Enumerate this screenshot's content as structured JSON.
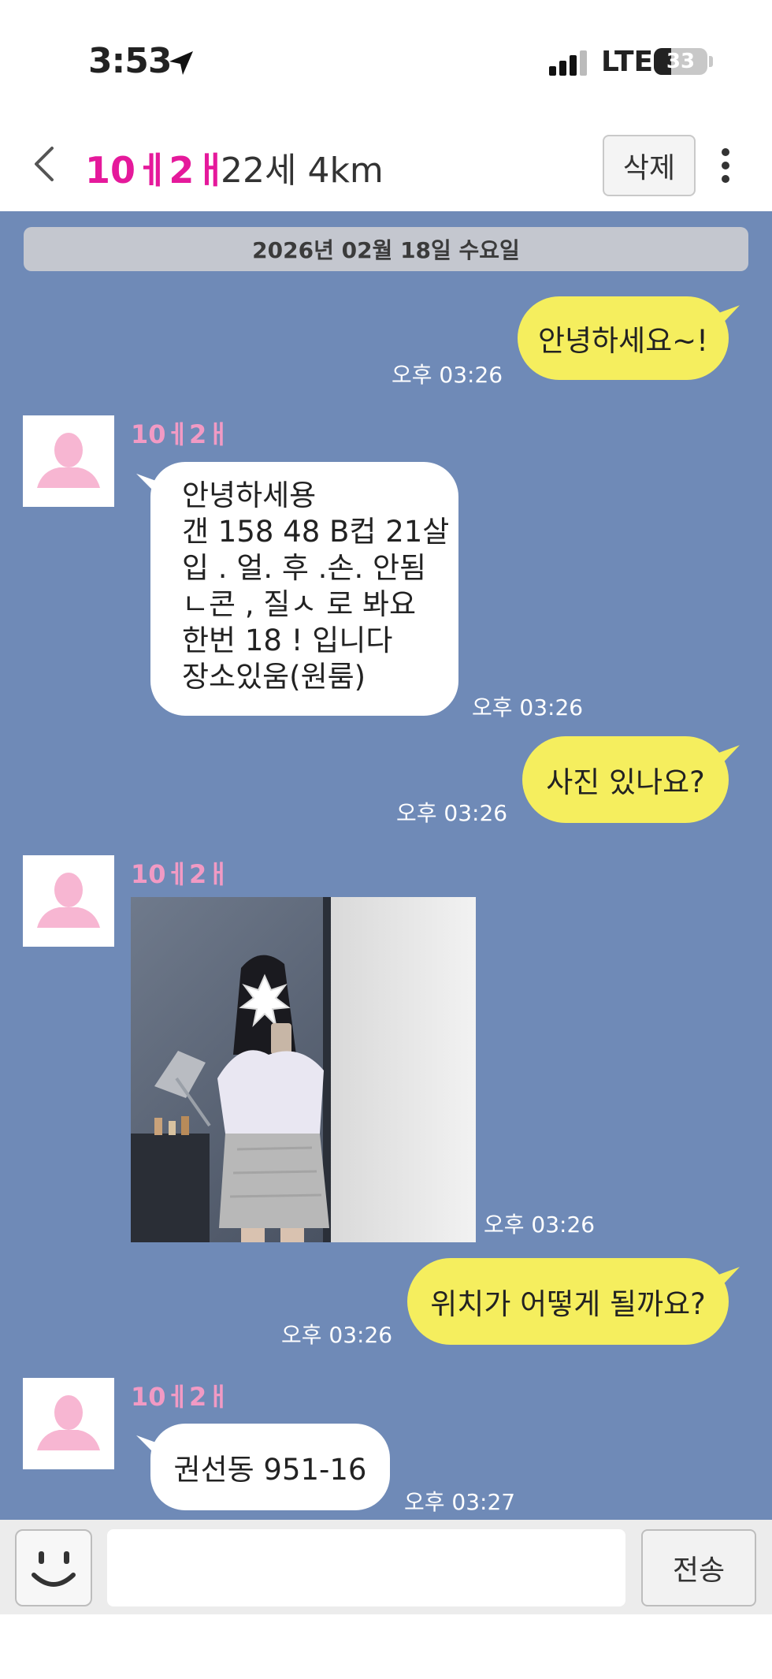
{
  "status_bar": {
    "time": "3:53",
    "network": "LTE",
    "battery": "33",
    "battery_level_percent": 33,
    "signal_bars": 3,
    "icons": [
      "location-arrow-icon",
      "signal-icon",
      "battery-icon"
    ]
  },
  "header": {
    "name": "10ㅔ2ㅐ",
    "info": "22세 4km",
    "delete_label": "삭제",
    "icons": [
      "chevron-left-icon",
      "more-vertical-icon"
    ]
  },
  "chat": {
    "date_divider": "2026년 02월 18일 수요일",
    "messages": [
      {
        "direction": "out",
        "text": "안녕하세요~!",
        "time": "오후 03:26"
      },
      {
        "direction": "in",
        "sender": "10ㅔ2ㅐ",
        "lines": [
          "안녕하세용",
          "갠 158 48 B컵 21살",
          "입 . 얼. 후 .손. 안됨",
          "ㄴ콘 , 질ㅅ 로 봐요",
          "한번 18 ! 입니다",
          "장소있움(원룸)"
        ],
        "time": "오후 03:26"
      },
      {
        "direction": "out",
        "text": "사진 있나요?",
        "time": "오후 03:26"
      },
      {
        "direction": "in",
        "sender": "10ㅔ2ㅐ",
        "type": "photo",
        "time": "오후 03:26"
      },
      {
        "direction": "out",
        "text": "위치가 어떻게 될까요?",
        "time": "오후 03:26"
      },
      {
        "direction": "in",
        "sender": "10ㅔ2ㅐ",
        "text": "권선동 951-16",
        "time": "오후 03:27"
      }
    ]
  },
  "input_bar": {
    "placeholder": "",
    "send_label": "전송",
    "icons": [
      "smiley-icon"
    ]
  },
  "colors": {
    "chat_background": "#6f8ab7",
    "outgoing_bubble": "#f5ee5e",
    "incoming_bubble": "#ffffff",
    "title_name": "#e5199b",
    "sender_name": "#f19ac4",
    "avatar_silhouette": "#f7b6d2"
  }
}
